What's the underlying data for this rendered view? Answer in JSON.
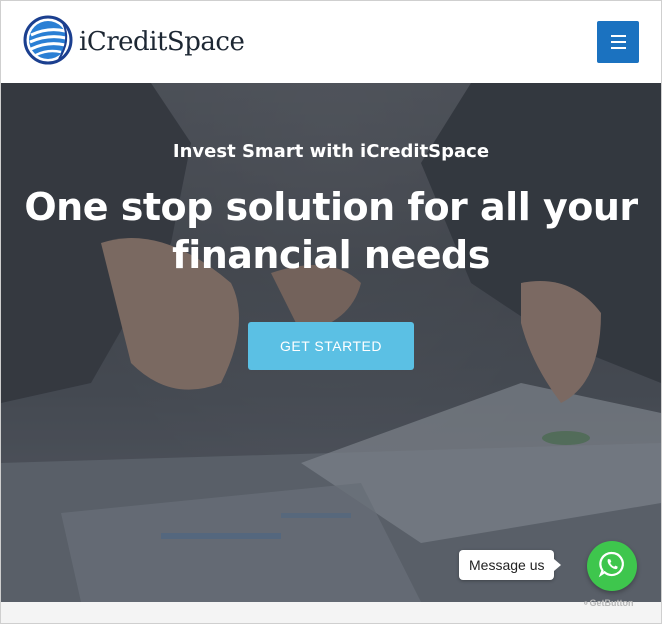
{
  "brand": {
    "name": "iCreditSpace",
    "logo_icon": "globe-stripes-icon"
  },
  "header": {
    "menu_icon": "hamburger-menu-icon"
  },
  "hero": {
    "subtitle": "Invest Smart with iCreditSpace",
    "title": "One stop solution for all your financial needs",
    "cta_label": "GET STARTED"
  },
  "chat_widget": {
    "bubble_text": "Message us",
    "icon": "whatsapp-icon",
    "powered_by": "GetButton"
  },
  "colors": {
    "menu_button": "#1b72c0",
    "cta": "#5bc0e4",
    "whatsapp": "#3ec64d",
    "logo_blue": "#1b72c0"
  }
}
